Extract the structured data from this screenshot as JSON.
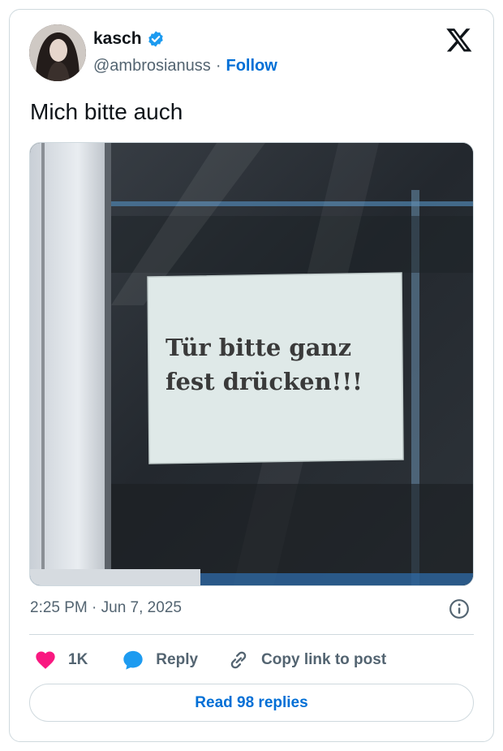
{
  "author": {
    "name": "kasch",
    "handle": "@ambrosianuss",
    "follow_label": "Follow",
    "verified": true
  },
  "tweet": {
    "text": "Mich bitte auch",
    "sign_text_line1": "Tür bitte ganz",
    "sign_text_line2": "fest drücken!!!",
    "timestamp": "2:25 PM · Jun 7, 2025"
  },
  "actions": {
    "like_count": "1K",
    "reply_label": "Reply",
    "copy_link_label": "Copy link to post"
  },
  "read_replies_label": "Read 98 replies",
  "icons": {
    "brand": "x-logo-icon",
    "verified": "verified-badge-icon",
    "info": "info-icon",
    "like": "heart-icon",
    "reply": "speech-bubble-icon",
    "copy": "link-icon"
  },
  "colors": {
    "accent": "#006fd6",
    "verified": "#1d9bf0",
    "like": "#f91880",
    "reply": "#1d9bf0",
    "muted": "#536471",
    "border": "#cfd9de"
  }
}
